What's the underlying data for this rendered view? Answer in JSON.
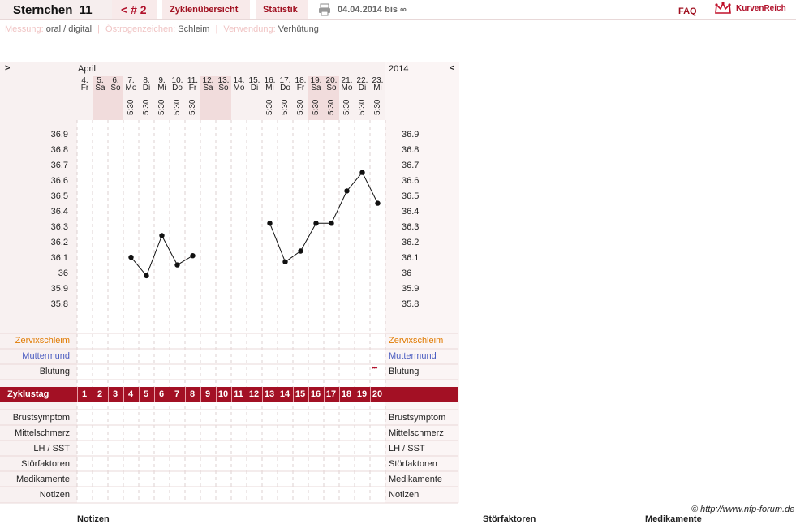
{
  "header": {
    "user": "Sternchen_11",
    "cycle": "< # 2",
    "tabs": [
      "Zyklenübersicht",
      "Statistik"
    ],
    "date_range": "04.04.2014 bis ∞",
    "faq": "FAQ",
    "logo": "KurvenReich",
    "printer_icon": "printer-icon"
  },
  "info": {
    "messung_label": "Messung:",
    "messung_value": "oral / digital",
    "oestrogen_label": "Östrogenzeichen:",
    "oestrogen_value": "Schleim",
    "verwendung_label": "Verwendung:",
    "verwendung_value": "Verhütung"
  },
  "chart_nav": {
    "prev": ">",
    "month": "April",
    "year": "2014",
    "next": "<"
  },
  "days": [
    {
      "d": "4.",
      "w": "Fr",
      "t": "",
      "shade": false
    },
    {
      "d": "5.",
      "w": "Sa",
      "t": "",
      "shade": true
    },
    {
      "d": "6.",
      "w": "So",
      "t": "",
      "shade": true
    },
    {
      "d": "7.",
      "w": "Mo",
      "t": "5:30",
      "shade": false
    },
    {
      "d": "8.",
      "w": "Di",
      "t": "5:30",
      "shade": false
    },
    {
      "d": "9.",
      "w": "Mi",
      "t": "5:30",
      "shade": false
    },
    {
      "d": "10.",
      "w": "Do",
      "t": "5:30",
      "shade": false
    },
    {
      "d": "11.",
      "w": "Fr",
      "t": "5:30",
      "shade": false
    },
    {
      "d": "12.",
      "w": "Sa",
      "t": "",
      "shade": true
    },
    {
      "d": "13.",
      "w": "So",
      "t": "",
      "shade": true
    },
    {
      "d": "14.",
      "w": "Mo",
      "t": "",
      "shade": false
    },
    {
      "d": "15.",
      "w": "Di",
      "t": "",
      "shade": false
    },
    {
      "d": "16.",
      "w": "Mi",
      "t": "5:30",
      "shade": false
    },
    {
      "d": "17.",
      "w": "Do",
      "t": "5:30",
      "shade": false
    },
    {
      "d": "18.",
      "w": "Fr",
      "t": "5:30",
      "shade": false
    },
    {
      "d": "19.",
      "w": "Sa",
      "t": "5:30",
      "shade": true
    },
    {
      "d": "20.",
      "w": "So",
      "t": "5:30",
      "shade": true
    },
    {
      "d": "21.",
      "w": "Mo",
      "t": "5:30",
      "shade": false
    },
    {
      "d": "22.",
      "w": "Di",
      "t": "5:30",
      "shade": false
    },
    {
      "d": "23.",
      "w": "Mi",
      "t": "5:30",
      "shade": false
    }
  ],
  "y_labels": [
    "36.9",
    "36.8",
    "36.7",
    "36.6",
    "36.5",
    "36.4",
    "36.3",
    "36.2",
    "36.1",
    "36",
    "35.9",
    "35.8"
  ],
  "chart_data": {
    "type": "line",
    "x": [
      7,
      8,
      9,
      10,
      11,
      16,
      17,
      18,
      19,
      20,
      21,
      22,
      23
    ],
    "y": [
      36.11,
      35.99,
      36.25,
      36.06,
      36.12,
      36.33,
      36.08,
      36.15,
      36.33,
      36.33,
      36.54,
      36.66,
      36.46
    ],
    "ylim": [
      35.8,
      36.9
    ]
  },
  "rows_top": [
    "Zervixschleim",
    "Muttermund",
    "Blutung"
  ],
  "row_colors": {
    "Zervixschleim": "#e07a00",
    "Muttermund": "#4a5cc0",
    "Blutung": "#222222"
  },
  "blutung_marker": "•••",
  "zyklustag": {
    "label": "Zyklustag",
    "numbers": [
      "1",
      "2",
      "3",
      "4",
      "5",
      "6",
      "7",
      "8",
      "9",
      "10",
      "11",
      "12",
      "13",
      "14",
      "15",
      "16",
      "17",
      "18",
      "19",
      "20"
    ]
  },
  "rows_bottom": [
    "Brustsymptom",
    "Mittelschmerz",
    "LH / SST",
    "Störfaktoren",
    "Medikamente",
    "Notizen"
  ],
  "footer": {
    "copyright": "© http://www.nfp-forum.de",
    "notizen": "Notizen",
    "stoerfaktoren": "Störfaktoren",
    "medikamente": "Medikamente"
  }
}
